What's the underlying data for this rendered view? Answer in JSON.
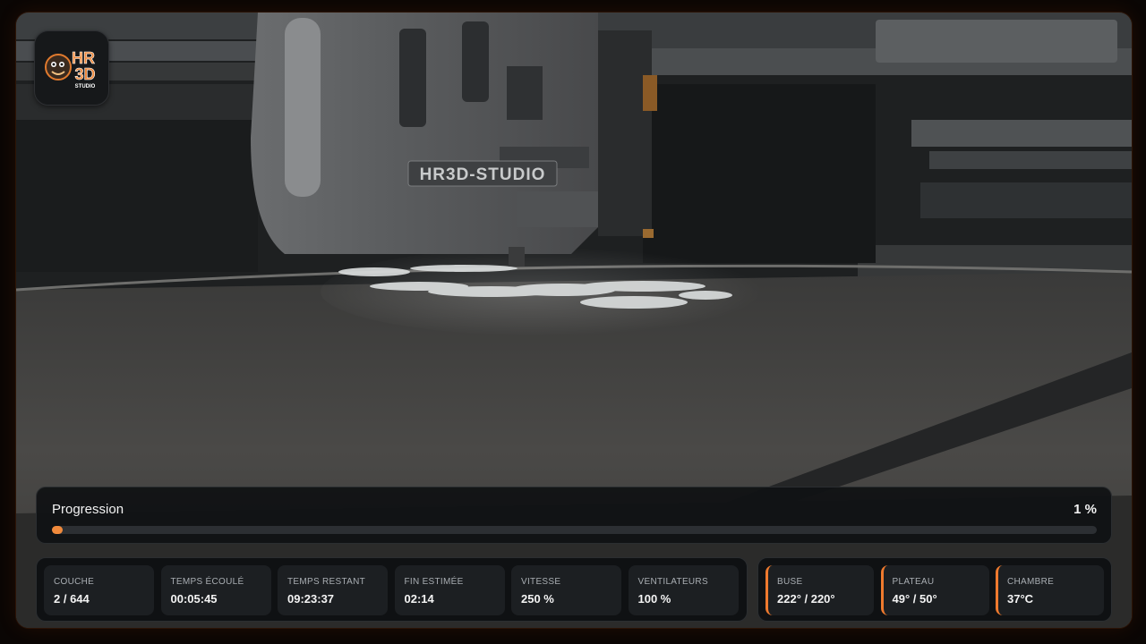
{
  "brand": {
    "logo_text_top": "HR",
    "logo_text_bottom": "3D",
    "logo_sub": "STUDIO",
    "printer_plate_text": "HR3D-STUDIO"
  },
  "progress": {
    "label": "Progression",
    "percent_text": "1 %",
    "fraction": 0.01
  },
  "stats": [
    {
      "key": "couche",
      "label": "COUCHE",
      "value": "2 / 644"
    },
    {
      "key": "temps-ecoule",
      "label": "TEMPS ÉCOULÉ",
      "value": "00:05:45"
    },
    {
      "key": "temps-restant",
      "label": "TEMPS RESTANT",
      "value": "09:23:37"
    },
    {
      "key": "fin-estimee",
      "label": "FIN ESTIMÉE",
      "value": "02:14"
    },
    {
      "key": "vitesse",
      "label": "VITESSE",
      "value": "250 %"
    },
    {
      "key": "ventilateurs",
      "label": "VENTILATEURS",
      "value": "100 %"
    }
  ],
  "temperatures": [
    {
      "key": "buse",
      "label": "BUSE",
      "value": "222° / 220°"
    },
    {
      "key": "plateau",
      "label": "PLATEAU",
      "value": "49° / 50°"
    },
    {
      "key": "chambre",
      "label": "CHAMBRE",
      "value": "37°C"
    }
  ],
  "colors": {
    "accent": "#f08a3c",
    "temp_accent": "#ef7a2e",
    "card_bg": "#1c1f22",
    "panel_bg": "#111315"
  }
}
